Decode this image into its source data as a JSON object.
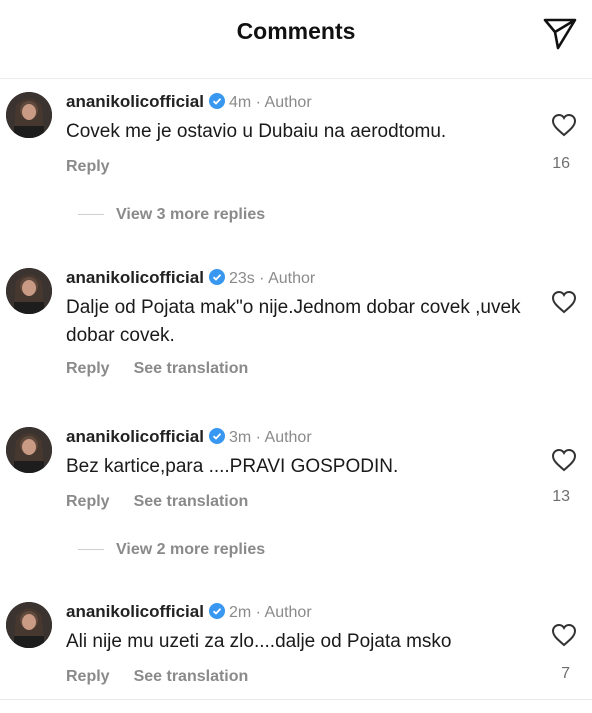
{
  "header": {
    "title": "Comments"
  },
  "comments": [
    {
      "username": "ananikolicofficial",
      "time": "4m",
      "badge": "Author",
      "text": "Covek me je ostavio u Dubaiu na aerodtomu.",
      "reply": "Reply",
      "translate": "",
      "likes": "16",
      "more_replies": "View 3 more replies"
    },
    {
      "username": "ananikolicofficial",
      "time": "23s",
      "badge": "Author",
      "text": "Dalje od Pojata mak\"o nije.Jednom dobar covek ,uvek dobar covek.",
      "reply": "Reply",
      "translate": "See translation",
      "likes": "",
      "more_replies": ""
    },
    {
      "username": "ananikolicofficial",
      "time": "3m",
      "badge": "Author",
      "text": "Bez kartice,para ....PRAVI GOSPODIN.",
      "reply": "Reply",
      "translate": "See translation",
      "likes": "13",
      "more_replies": "View 2 more replies"
    },
    {
      "username": "ananikolicofficial",
      "time": "2m",
      "badge": "Author",
      "text": "Ali nije mu uzeti za zlo....dalje od Pojata msko",
      "reply": "Reply",
      "translate": "See translation",
      "likes": "7",
      "more_replies": ""
    }
  ],
  "icons": {
    "send": "send-icon",
    "heart": "heart-icon",
    "verified": "verified-badge-icon"
  },
  "colors": {
    "verified": "#3897f0",
    "meta": "#8a8a8a"
  }
}
